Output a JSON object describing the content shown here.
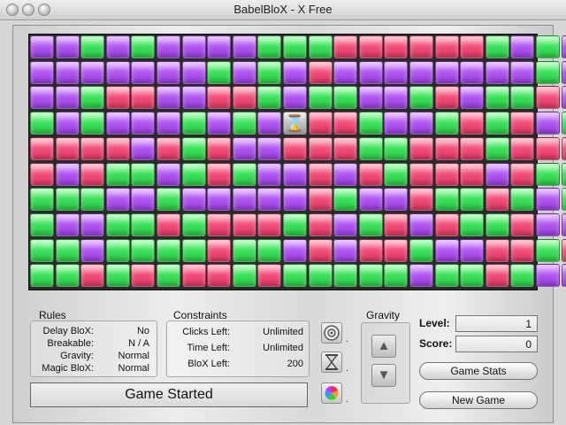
{
  "window": {
    "title": "BabelBloX - X Free"
  },
  "board": {
    "rows": [
      "ppgpgppppgggrrrrrrgpgp",
      "pppppppgpgprppppppppgp",
      "ppgrrpprrgpggppgrpggrp",
      "gpgpppgpgphrrgppgrgrpg",
      "rrrrprgrpprrrggrrrgrrr",
      "rprggpgrgpprprgrrrprgg",
      "gggppgppppprgpprggrgpg",
      "gppggrgrrrgrpgrprggrpp",
      "ggpggggrggprprrgpprrgr",
      "ggrgrgrrgrgggggpggrgpp"
    ]
  },
  "rules": {
    "header": "Rules",
    "delay_label": "Delay BloX:",
    "delay_value": "No",
    "breakable_label": "Breakable:",
    "breakable_value": "N / A",
    "gravity_label": "Gravity:",
    "gravity_value": "Normal",
    "magic_label": "Magic BloX:",
    "magic_value": "Normal"
  },
  "constraints": {
    "header": "Constraints",
    "clicks_label": "Clicks Left:",
    "clicks_value": "Unlimited",
    "time_label": "Time Left:",
    "time_value": "Unlimited",
    "blox_label": "BloX Left:",
    "blox_value": "200"
  },
  "gravity_panel": {
    "header": "Gravity"
  },
  "status": {
    "text": "Game Started"
  },
  "stats": {
    "level_label": "Level:",
    "level_value": "1",
    "score_label": "Score:",
    "score_value": "0"
  },
  "buttons": {
    "game_stats": "Game Stats",
    "new_game": "New Game"
  },
  "tool_icons": [
    "target-icon",
    "hourglass-icon",
    "magic-blox-icon"
  ],
  "colors": {
    "purple": "#b056f0",
    "green": "#3be05a",
    "red": "#f04d78"
  }
}
